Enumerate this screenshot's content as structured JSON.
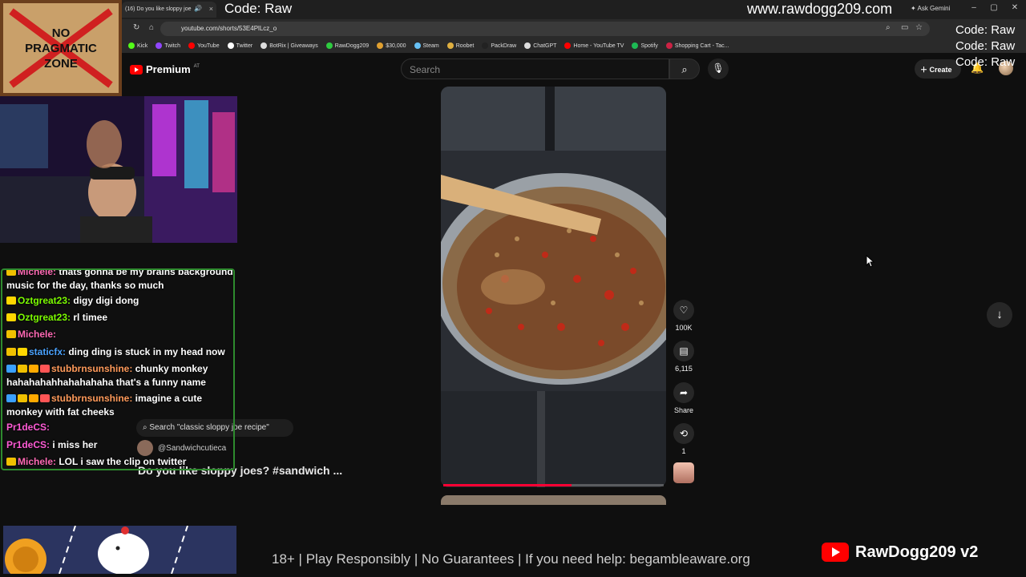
{
  "browser": {
    "tab_title": "(16) Do you like sloppy joe",
    "tab_close": "×",
    "address": "youtube.com/shorts/53E4PlLcz_o",
    "ask_gemini": "Ask Gemini",
    "bookmarks": [
      {
        "label": "Kick",
        "color": "#53fc18"
      },
      {
        "label": "Twitch",
        "color": "#9146ff"
      },
      {
        "label": "YouTube",
        "color": "#ff0000"
      },
      {
        "label": "Twitter",
        "color": "#ffffff"
      },
      {
        "label": "BotRix | Giveaways",
        "color": "#dddddd"
      },
      {
        "label": "RawDogg209",
        "color": "#2ecc40"
      },
      {
        "label": "$30,000",
        "color": "#e0a030"
      },
      {
        "label": "Steam",
        "color": "#66c0f4"
      },
      {
        "label": "Roobet",
        "color": "#e0b040"
      },
      {
        "label": "PackDraw",
        "color": "#222222"
      },
      {
        "label": "ChatGPT",
        "color": "#dddddd"
      },
      {
        "label": "Home - YouTube TV",
        "color": "#ff0000"
      },
      {
        "label": "Spotify",
        "color": "#1db954"
      },
      {
        "label": "Shopping Cart - Tac...",
        "color": "#cc2244"
      }
    ]
  },
  "overlays": {
    "code_title": "Code: Raw",
    "site_url": "www.rawdogg209.com",
    "code_right": [
      "Code: Raw",
      "Code: Raw",
      "Code: Raw"
    ],
    "no_zone": [
      "NO",
      "PRAGMATIC",
      "ZONE"
    ],
    "disclaimer": "18+ | Play Responsibly | No Guarantees | If you need help: begambleaware.org",
    "brand_name": "RawDogg209 v2"
  },
  "youtube": {
    "premium_label": "Premium",
    "region": "AT",
    "search_placeholder": "Search",
    "create_label": "Create",
    "likes": "100K",
    "comments": "6,115",
    "share_label": "Share",
    "remix_count": "1",
    "progress": 0.58,
    "suggest_search": "Search \"classic sloppy joe recipe\"",
    "channel_handle": "@Sandwichcutieca",
    "short_title": "Do you like sloppy joes? #sandwich ..."
  },
  "chat": [
    {
      "user": "Michele:",
      "user_color": "#ff69b4",
      "text": " thats gonna be my brains background music for the day, thanks so much",
      "badges": [
        "#f0c000"
      ]
    },
    {
      "user": "Oztgreat23:",
      "user_color": "#7cfc00",
      "text": " digy digi dong",
      "badges": [
        "#ffd700"
      ]
    },
    {
      "user": "Oztgreat23:",
      "user_color": "#7cfc00",
      "text": " rl timee",
      "badges": [
        "#ffd700"
      ]
    },
    {
      "user": "Michele:",
      "user_color": "#ff69b4",
      "text": " ",
      "badges": [
        "#f0c000"
      ]
    },
    {
      "user": "staticfx:",
      "user_color": "#4aa3ff",
      "text": " ding ding is stuck in my head now",
      "badges": [
        "#f0c000",
        "#ffd700"
      ]
    },
    {
      "user": "stubbrnsunshine:",
      "user_color": "#ff9a5a",
      "text": " chunky monkey hahahahahhahahahaha that's a funny name",
      "badges": [
        "#3aa0ff",
        "#f0c000",
        "#ffaa00",
        "#ff5555"
      ]
    },
    {
      "user": "stubbrnsunshine:",
      "user_color": "#ff9a5a",
      "text": " imagine a cute monkey with fat cheeks",
      "badges": [
        "#3aa0ff",
        "#f0c000",
        "#ffaa00",
        "#ff5555"
      ]
    },
    {
      "user": "Pr1deCS:",
      "user_color": "#ff5bd6",
      "text": " ",
      "badges": []
    },
    {
      "user": "Pr1deCS:",
      "user_color": "#ff5bd6",
      "text": " i miss her",
      "badges": []
    },
    {
      "user": "Michele:",
      "user_color": "#ff69b4",
      "text": " LOL i saw the clip on twitter",
      "badges": [
        "#f0c000"
      ]
    }
  ]
}
